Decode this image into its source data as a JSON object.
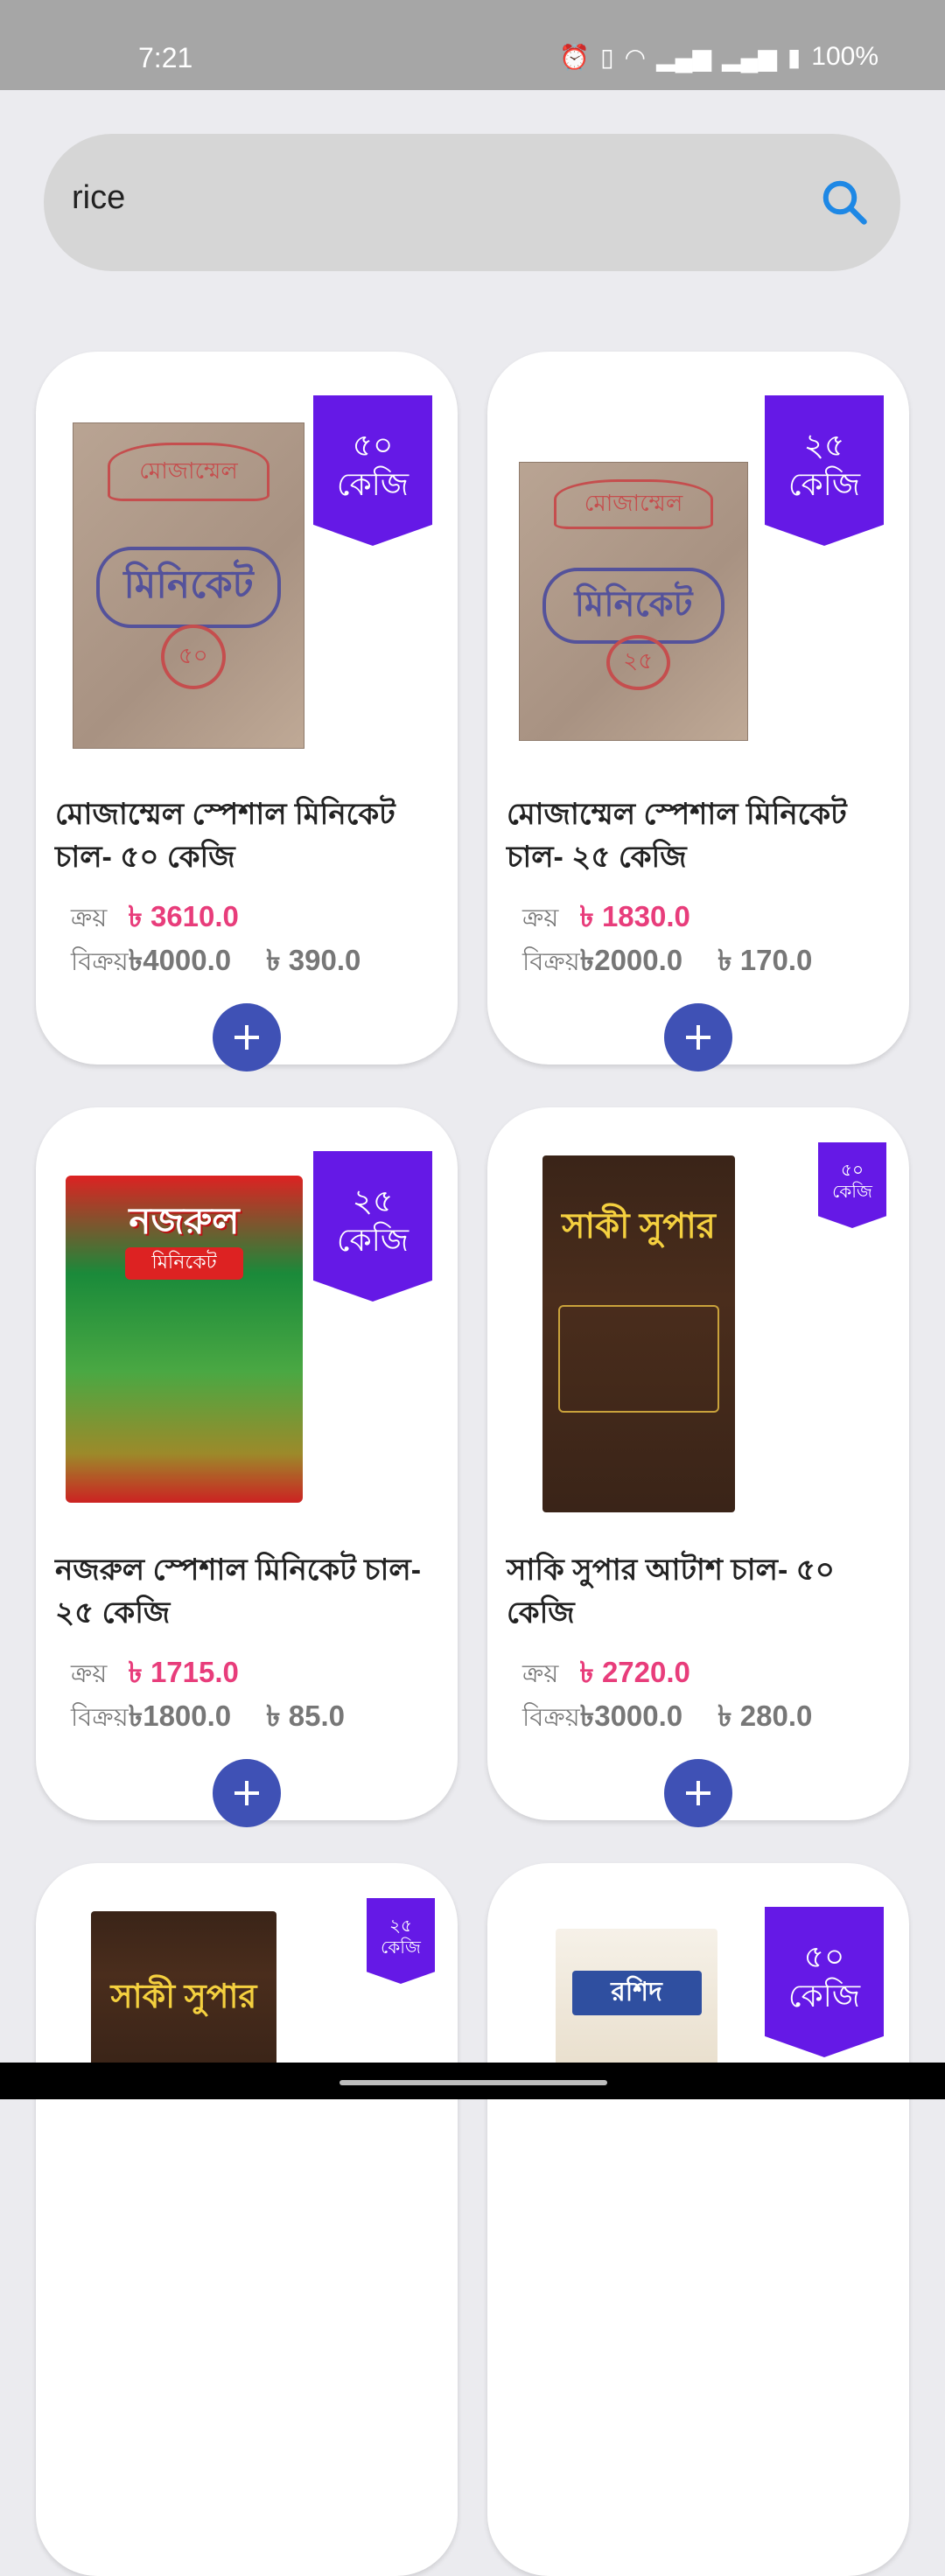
{
  "status_bar": {
    "time": "7:21",
    "battery": "100%"
  },
  "search": {
    "value": "rice"
  },
  "labels": {
    "buy": "ক্রয়",
    "sell": "বিক্রয়"
  },
  "products": [
    {
      "badge_line1": "৫০",
      "badge_line2": "কেজি",
      "name": "মোজাম্মেল স্পেশাল মিনিকেট চাল- ৫০ কেজি",
      "buy_price": "৳ 3610.0",
      "sell_price": "৳4000.0",
      "profit": "৳ 390.0",
      "sack_label": "মিনিকেট",
      "sack_seal": "৫০",
      "sack_brand": "মোজাম্মেল"
    },
    {
      "badge_line1": "২৫",
      "badge_line2": "কেজি",
      "name": "মোজাম্মেল স্পেশাল মিনিকেট চাল- ২৫ কেজি",
      "buy_price": "৳ 1830.0",
      "sell_price": "৳2000.0",
      "profit": "৳ 170.0",
      "sack_label": "মিনিকেট",
      "sack_seal": "২৫",
      "sack_brand": "মোজাম্মেল"
    },
    {
      "badge_line1": "২৫",
      "badge_line2": "কেজি",
      "name": "নজরুল স্পেশাল মিনিকেট চাল- ২৫ কেজি",
      "buy_price": "৳ 1715.0",
      "sell_price": "৳1800.0",
      "profit": "৳ 85.0",
      "sack_brand": "নজরুল",
      "sack_label": "মিনিকেট"
    },
    {
      "badge_line1": "৫০",
      "badge_line2": "কেজি",
      "name": "সাকি সুপার আটাশ চাল- ৫০ কেজি",
      "buy_price": "৳ 2720.0",
      "sell_price": "৳3000.0",
      "profit": "৳ 280.0",
      "sack_brand": "সাকী সুপার"
    },
    {
      "badge_line1": "২৫",
      "badge_line2": "কেজি",
      "sack_brand": "সাকী সুপার"
    },
    {
      "badge_line1": "৫০",
      "badge_line2": "কেজি",
      "sack_brand": "রশিদ"
    }
  ]
}
